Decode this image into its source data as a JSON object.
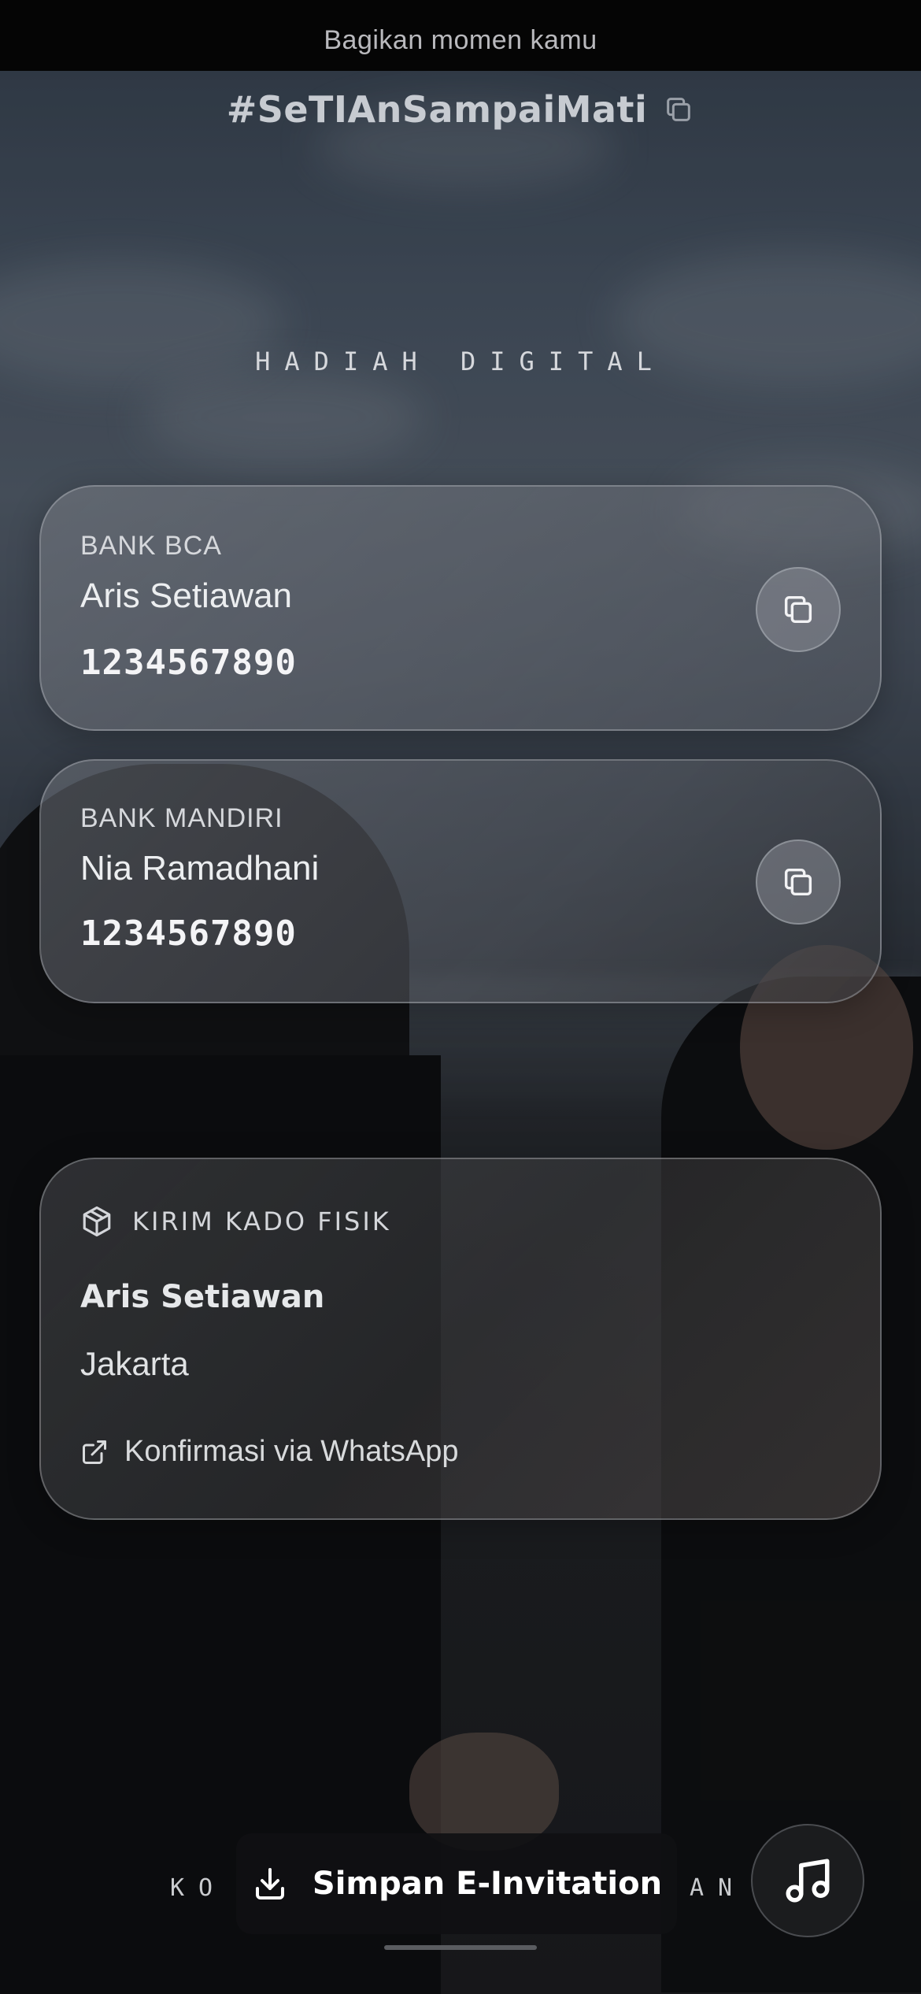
{
  "status_bar": {
    "text": "Bagikan momen kamu"
  },
  "hashtag": {
    "text": "#SeTIAnSampaiMati",
    "icon": "copy-icon"
  },
  "gift_section": {
    "title": "HADIAH DIGITAL"
  },
  "bank_accounts": [
    {
      "bank": "BANK BCA",
      "holder": "Aris Setiawan",
      "number": "1234567890",
      "icon": "copy-icon"
    },
    {
      "bank": "BANK MANDIRI",
      "holder": "Nia Ramadhani",
      "number": "1234567890",
      "icon": "copy-icon"
    }
  ],
  "physical_gift": {
    "title": "KIRIM KADO FISIK",
    "icon": "package-icon",
    "name": "Aris Setiawan",
    "city": "Jakarta",
    "link_label": "Konfirmasi via WhatsApp",
    "link_icon": "external-link-icon"
  },
  "footer": {
    "left_letters": "KO",
    "right_letters": "AN",
    "save_label": "Simpan E-Invitation",
    "save_icon": "download-icon",
    "music_icon": "music-note-icon"
  },
  "colors": {
    "background_top": "#4a5766",
    "background_bottom": "#1b1c1e",
    "card_border": "#c8ccd2",
    "button_dark": "#101012"
  }
}
